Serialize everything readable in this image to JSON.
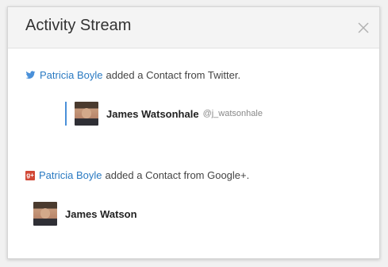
{
  "dialog": {
    "title": "Activity Stream",
    "close_icon": "close-icon"
  },
  "activities": [
    {
      "source": "twitter",
      "icon": "twitter-bird-icon",
      "icon_color": "#4a90d9",
      "user": "Patricia Boyle",
      "text": "added a Contact from Twitter.",
      "contact": {
        "name": "James Watsonhale",
        "handle": "@j_watsonhale"
      }
    },
    {
      "source": "google-plus",
      "icon": "google-plus-icon",
      "icon_color": "#d14836",
      "icon_glyph": "g+",
      "user": "Patricia Boyle",
      "text": "added a Contact from Google+.",
      "contact": {
        "name": "James Watson"
      }
    }
  ],
  "colors": {
    "link": "#2a7ac2",
    "accent": "#4a90d9"
  }
}
